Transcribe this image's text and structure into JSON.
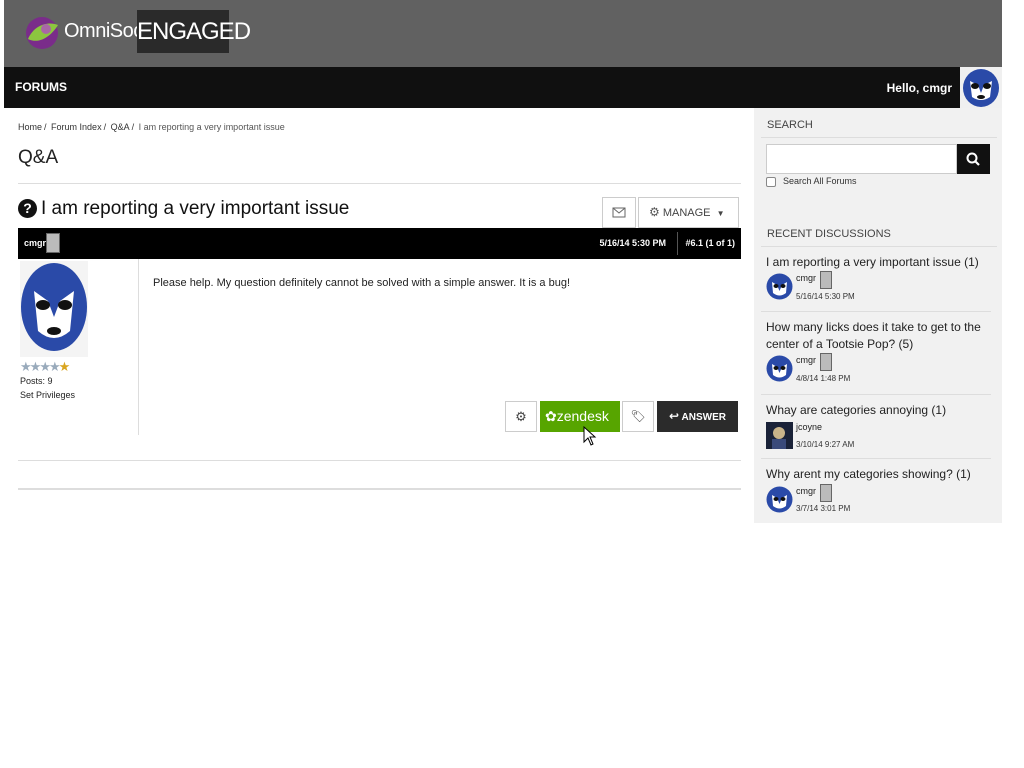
{
  "brand": {
    "name": "OmniSocial",
    "badge": "ENGAGED"
  },
  "nav": {
    "forums_label": "FORUMS",
    "greeting": "Hello, cmgr"
  },
  "breadcrumb": [
    "Home",
    "Forum Index",
    "Q&A",
    "I am reporting a very important issue"
  ],
  "page_title": "Q&A",
  "topic": {
    "title": "I am reporting a very important issue",
    "manage_label": "MANAGE"
  },
  "post": {
    "author": "cmgr",
    "date": "5/16/14 5:30 PM",
    "number": "#6.1 (1 of 1)",
    "posts": "Posts: 9",
    "privileges_label": "Set Privileges",
    "stars": 4,
    "body": "Please help. My question definitely cannot be solved with a simple answer. It is a bug!",
    "zendesk_label": "zendesk",
    "answer_label": "ANSWER"
  },
  "sidebar": {
    "search_heading": "SEARCH",
    "search_value": "",
    "search_all_label": "Search All Forums",
    "recent_heading": "RECENT DISCUSSIONS",
    "discussions": [
      {
        "title": "I am reporting a very important issue (1)",
        "user": "cmgr",
        "date": "5/16/14 5:30 PM"
      },
      {
        "title": "How many licks does it take to get to the center of a Tootsie Pop? (5)",
        "user": "cmgr",
        "date": "4/8/14 1:48 PM"
      },
      {
        "title": "Whay are categories annoying (1)",
        "user": "jcoyne",
        "date": "3/10/14 9:27 AM"
      },
      {
        "title": "Why arent my categories showing? (1)",
        "user": "cmgr",
        "date": "3/7/14 3:01 PM"
      }
    ]
  },
  "colors": {
    "header_bg": "#616161",
    "nav_bg": "#101010",
    "zendesk_green": "#57a500",
    "mask_blue": "#2a4aa8"
  }
}
